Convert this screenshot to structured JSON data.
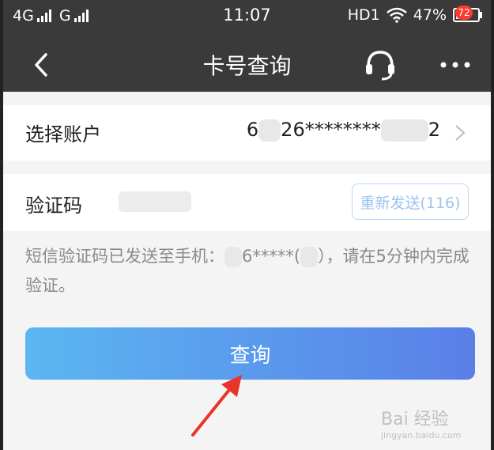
{
  "status_bar": {
    "network_1": "4G",
    "network_2": "G",
    "time": "11:07",
    "hd": "HD1",
    "battery_text": "47%",
    "battery_level": 0.47
  },
  "nav": {
    "back_icon": "chevron-left-icon",
    "title": "卡号查询",
    "service_icon": "headset-icon",
    "more_icon": "more-dots-icon",
    "badge": "72"
  },
  "account": {
    "label": "选择账户",
    "value_prefix": "6",
    "value_mid": "26********",
    "value_suffix": "2"
  },
  "verify": {
    "label": "验证码",
    "input_value": "",
    "resend_button": "重新发送(116)"
  },
  "hint": {
    "text_before": "短信验证码已发送至手机：",
    "masked_phone": "6*****(",
    "text_after": "），请在5分钟内完成验证。"
  },
  "query_button": "查询",
  "watermark": {
    "brand": "Bai 经验",
    "url": "jingyan.baidu.com"
  },
  "colors": {
    "nav_bg": "#3a3a3a",
    "button_gradient_start": "#5bb6f1",
    "button_gradient_end": "#5a7fe8",
    "arrow": "#e8352b",
    "badge": "#ff3b30"
  }
}
